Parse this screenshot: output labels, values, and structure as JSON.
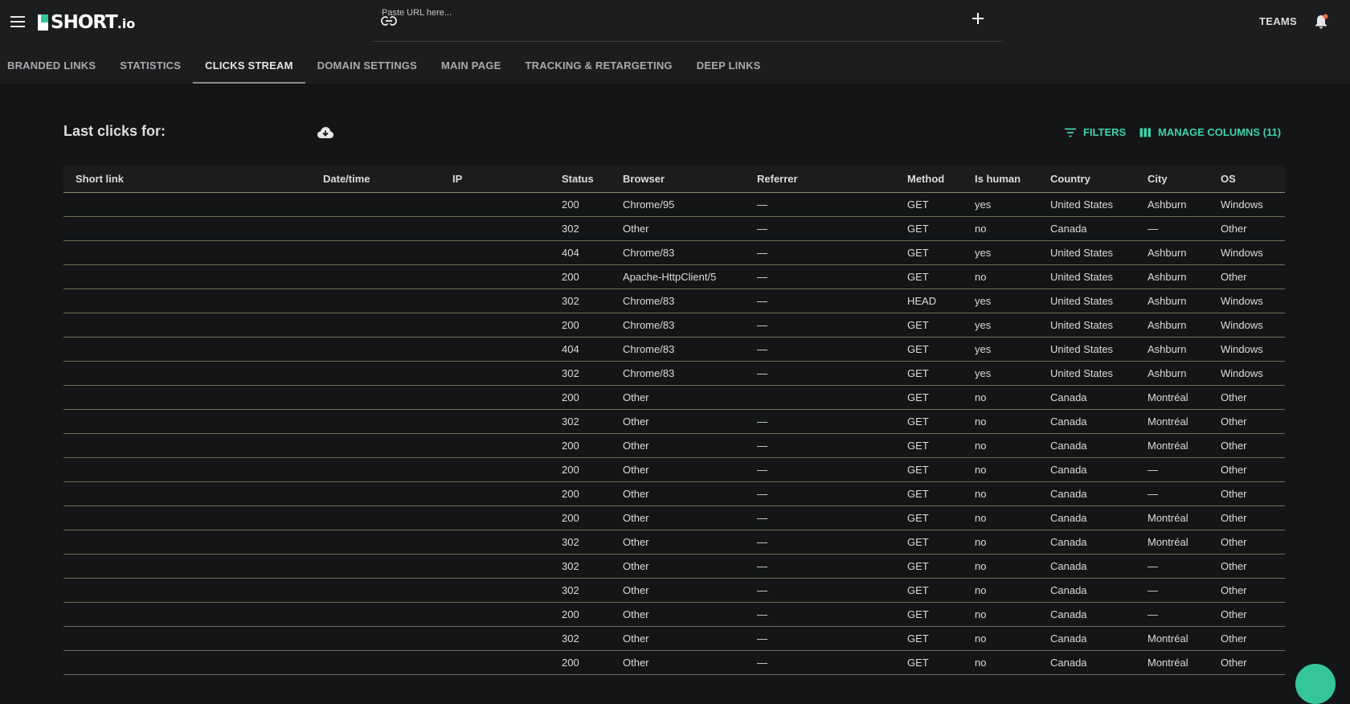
{
  "header": {
    "logo_text": "SHORT",
    "logo_suffix": ".io",
    "url_placeholder": "Paste URL here...",
    "teams_label": "TEAMS",
    "accent_color": "#42d3a7"
  },
  "tabs": [
    {
      "label": "BRANDED LINKS",
      "active": false
    },
    {
      "label": "STATISTICS",
      "active": false
    },
    {
      "label": "CLICKS STREAM",
      "active": true
    },
    {
      "label": "DOMAIN SETTINGS",
      "active": false
    },
    {
      "label": "MAIN PAGE",
      "active": false
    },
    {
      "label": "TRACKING & RETARGETING",
      "active": false
    },
    {
      "label": "DEEP LINKS",
      "active": false
    }
  ],
  "toolbar": {
    "title": "Last clicks for:",
    "filters_label": "FILTERS",
    "manage_columns_label": "MANAGE COLUMNS (11)"
  },
  "table": {
    "columns": [
      "Short link",
      "Date/time",
      "IP",
      "Status",
      "Browser",
      "Referrer",
      "Method",
      "Is human",
      "Country",
      "City",
      "OS"
    ],
    "rows": [
      [
        "",
        "",
        "",
        "200",
        "Chrome/95",
        "—",
        "GET",
        "yes",
        "United States",
        "Ashburn",
        "Windows"
      ],
      [
        "",
        "",
        "",
        "302",
        "Other",
        "—",
        "GET",
        "no",
        "Canada",
        "—",
        "Other"
      ],
      [
        "",
        "",
        "",
        "404",
        "Chrome/83",
        "—",
        "GET",
        "yes",
        "United States",
        "Ashburn",
        "Windows"
      ],
      [
        "",
        "",
        "",
        "200",
        "Apache-HttpClient/5",
        "—",
        "GET",
        "no",
        "United States",
        "Ashburn",
        "Other"
      ],
      [
        "",
        "",
        "",
        "302",
        "Chrome/83",
        "—",
        "HEAD",
        "yes",
        "United States",
        "Ashburn",
        "Windows"
      ],
      [
        "",
        "",
        "",
        "200",
        "Chrome/83",
        "—",
        "GET",
        "yes",
        "United States",
        "Ashburn",
        "Windows"
      ],
      [
        "",
        "",
        "",
        "404",
        "Chrome/83",
        "—",
        "GET",
        "yes",
        "United States",
        "Ashburn",
        "Windows"
      ],
      [
        "",
        "",
        "",
        "302",
        "Chrome/83",
        "—",
        "GET",
        "yes",
        "United States",
        "Ashburn",
        "Windows"
      ],
      [
        "",
        "",
        "",
        "200",
        "Other",
        "",
        "GET",
        "no",
        "Canada",
        "Montréal",
        "Other"
      ],
      [
        "",
        "",
        "",
        "302",
        "Other",
        "—",
        "GET",
        "no",
        "Canada",
        "Montréal",
        "Other"
      ],
      [
        "",
        "",
        "",
        "200",
        "Other",
        "—",
        "GET",
        "no",
        "Canada",
        "Montréal",
        "Other"
      ],
      [
        "",
        "",
        "",
        "200",
        "Other",
        "—",
        "GET",
        "no",
        "Canada",
        "—",
        "Other"
      ],
      [
        "",
        "",
        "",
        "200",
        "Other",
        "—",
        "GET",
        "no",
        "Canada",
        "—",
        "Other"
      ],
      [
        "",
        "",
        "",
        "200",
        "Other",
        "—",
        "GET",
        "no",
        "Canada",
        "Montréal",
        "Other"
      ],
      [
        "",
        "",
        "",
        "302",
        "Other",
        "—",
        "GET",
        "no",
        "Canada",
        "Montréal",
        "Other"
      ],
      [
        "",
        "",
        "",
        "302",
        "Other",
        "—",
        "GET",
        "no",
        "Canada",
        "—",
        "Other"
      ],
      [
        "",
        "",
        "",
        "302",
        "Other",
        "—",
        "GET",
        "no",
        "Canada",
        "—",
        "Other"
      ],
      [
        "",
        "",
        "",
        "200",
        "Other",
        "—",
        "GET",
        "no",
        "Canada",
        "—",
        "Other"
      ],
      [
        "",
        "",
        "",
        "302",
        "Other",
        "—",
        "GET",
        "no",
        "Canada",
        "Montréal",
        "Other"
      ],
      [
        "",
        "",
        "",
        "200",
        "Other",
        "—",
        "GET",
        "no",
        "Canada",
        "Montréal",
        "Other"
      ]
    ]
  }
}
